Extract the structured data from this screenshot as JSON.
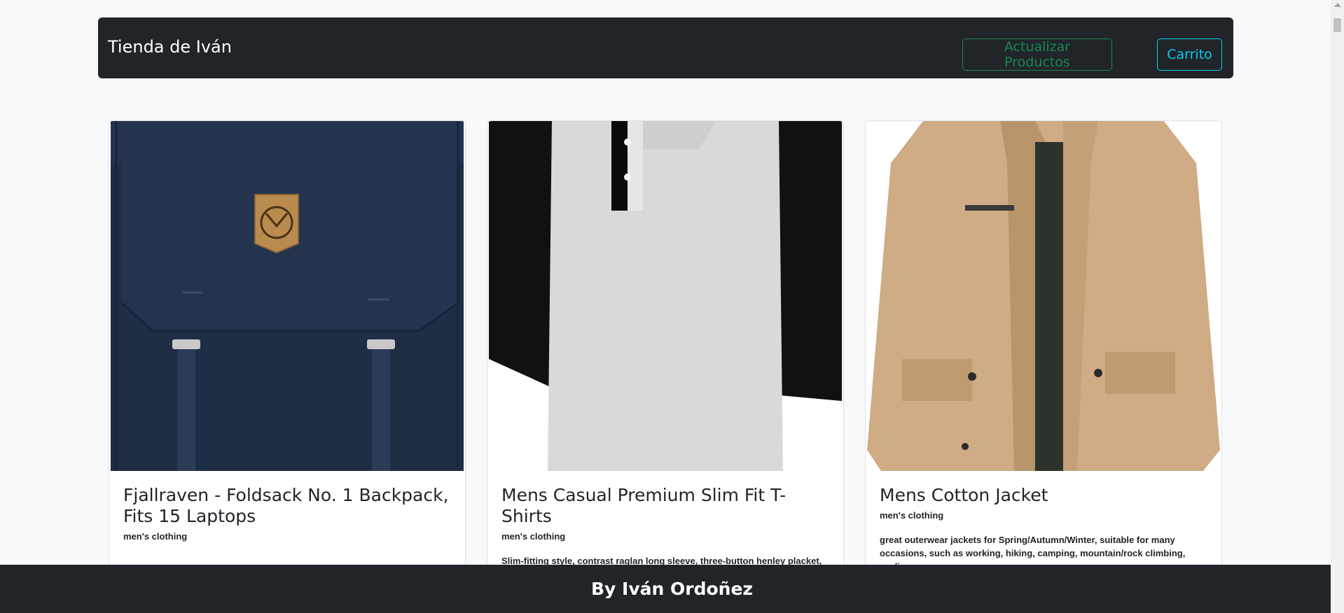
{
  "navbar": {
    "brand": "Tienda de Iván",
    "update_label": "Actualizar Productos",
    "cart_label": "Carrito"
  },
  "products": [
    {
      "title": "Fjallraven - Foldsack No. 1 Backpack, Fits 15 Laptops",
      "category": "men's clothing",
      "description": ""
    },
    {
      "title": "Mens Casual Premium Slim Fit T-Shirts",
      "category": "men's clothing",
      "description": "Slim-fitting style, contrast raglan long sleeve, three-button henley placket, light weight & soft fabric for breathable and comfortable wearing. And Solid"
    },
    {
      "title": "Mens Cotton Jacket",
      "category": "men's clothing",
      "description": "great outerwear jackets for Spring/Autumn/Winter, suitable for many occasions, such as working, hiking, camping, mountain/rock climbing, cycling,"
    }
  ],
  "footer": {
    "text": "By Iván Ordoñez"
  }
}
